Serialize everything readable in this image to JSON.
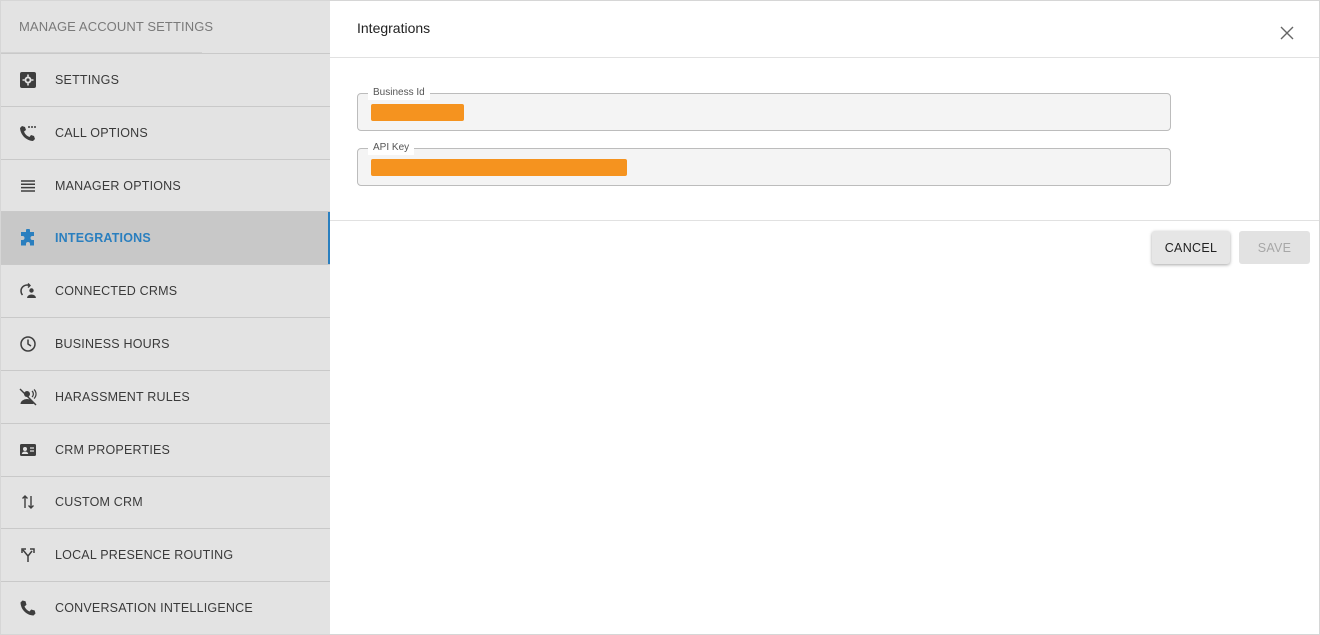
{
  "sidebar": {
    "header": "MANAGE ACCOUNT SETTINGS",
    "items": [
      {
        "label": "SETTINGS",
        "icon": "gear-box-icon"
      },
      {
        "label": "CALL OPTIONS",
        "icon": "phone-dots-icon"
      },
      {
        "label": "MANAGER OPTIONS",
        "icon": "lines-icon"
      },
      {
        "label": "INTEGRATIONS",
        "icon": "puzzle-icon",
        "active": true
      },
      {
        "label": "CONNECTED CRMS",
        "icon": "sync-person-icon"
      },
      {
        "label": "BUSINESS HOURS",
        "icon": "clock-icon"
      },
      {
        "label": "HARASSMENT RULES",
        "icon": "voice-off-icon"
      },
      {
        "label": "CRM PROPERTIES",
        "icon": "contact-card-icon"
      },
      {
        "label": "CUSTOM CRM",
        "icon": "swap-vertical-icon"
      },
      {
        "label": "LOCAL PRESENCE ROUTING",
        "icon": "fork-icon"
      },
      {
        "label": "CONVERSATION INTELLIGENCE",
        "icon": "phone-icon"
      }
    ]
  },
  "main": {
    "title": "Integrations",
    "fields": {
      "business_id": {
        "label": "Business Id",
        "value": "redacted"
      },
      "api_key": {
        "label": "API Key",
        "value": "redacted"
      }
    },
    "actions": {
      "cancel": "CANCEL",
      "save": "SAVE"
    }
  },
  "colors": {
    "accent": "#2a7fbf",
    "redaction": "#f5931f",
    "sidebar_bg": "#e3e3e3",
    "active_bg": "#c8c8c8"
  }
}
